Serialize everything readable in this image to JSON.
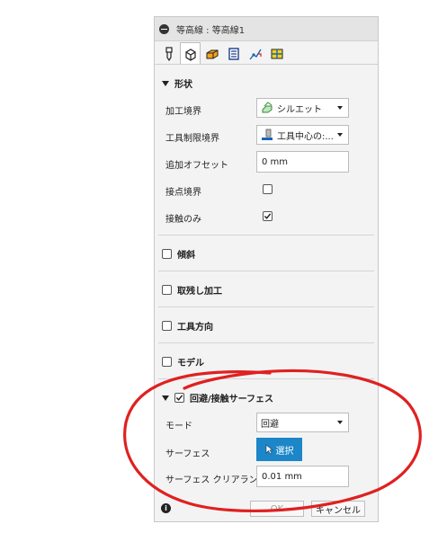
{
  "window": {
    "title": "等高線 : 等高線1"
  },
  "tabs": [
    {
      "name": "tool-tab"
    },
    {
      "name": "geometry-tab"
    },
    {
      "name": "heights-tab"
    },
    {
      "name": "passes-tab"
    },
    {
      "name": "linking-tab"
    },
    {
      "name": "post-tab"
    }
  ],
  "shape": {
    "header": "形状",
    "machining_boundary": {
      "label": "加工境界",
      "value": "シルエット"
    },
    "tool_containment": {
      "label": "工具制限境界",
      "value": "工具中心の:..."
    },
    "additional_offset": {
      "label": "追加オフセット",
      "value": "0 mm"
    },
    "contact_boundary": {
      "label": "接点境界",
      "checked": false
    },
    "contact_only": {
      "label": "接触のみ",
      "checked": true
    }
  },
  "sections": {
    "slope": "傾斜",
    "rest_machining": "取残し加工",
    "tool_orientation": "工具方向",
    "model": "モデル"
  },
  "avoid": {
    "header": "回避/接触サーフェス",
    "checked": true,
    "mode": {
      "label": "モード",
      "value": "回避"
    },
    "surface": {
      "label": "サーフェス",
      "button": "選択"
    },
    "clearance": {
      "label": "サーフェス クリアランス",
      "value": "0.01 mm"
    }
  },
  "footer": {
    "ok": "OK",
    "cancel": "キャンセル"
  },
  "colors": {
    "accent": "#1c86c8",
    "annotation": "#e02020"
  }
}
